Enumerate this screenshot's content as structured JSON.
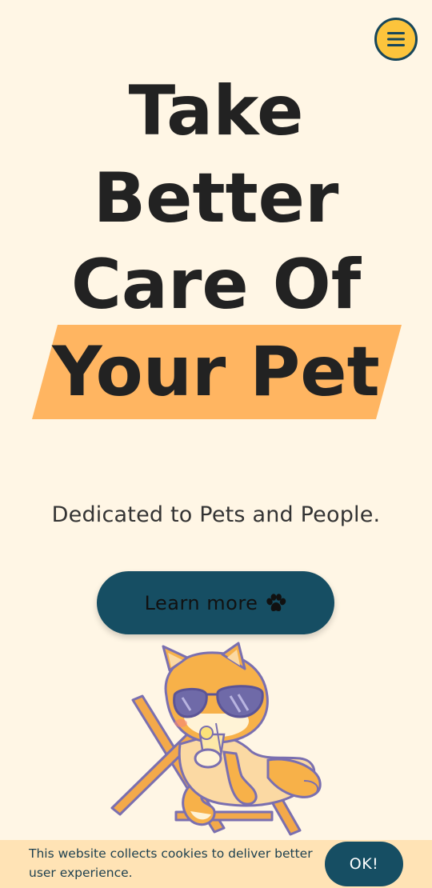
{
  "header": {
    "menu_icon": "hamburger-menu-icon"
  },
  "hero": {
    "line1": "Take",
    "line2": "Better",
    "line3": "Care Of",
    "line4": "Your Pet",
    "tagline": "Dedicated to Pets and People.",
    "cta_label": "Learn more",
    "cta_icon": "paw-icon",
    "illustration": "shiba-dog-sunglasses-beach-chair"
  },
  "cookie_banner": {
    "message": "This website collects cookies to deliver better user experience.",
    "ok_label": "OK!"
  },
  "colors": {
    "background": "#fff6e5",
    "highlight": "#ffb561",
    "primary": "#164e63",
    "menu_button": "#fcc43c",
    "cookie_bar": "#ffdeaa"
  }
}
